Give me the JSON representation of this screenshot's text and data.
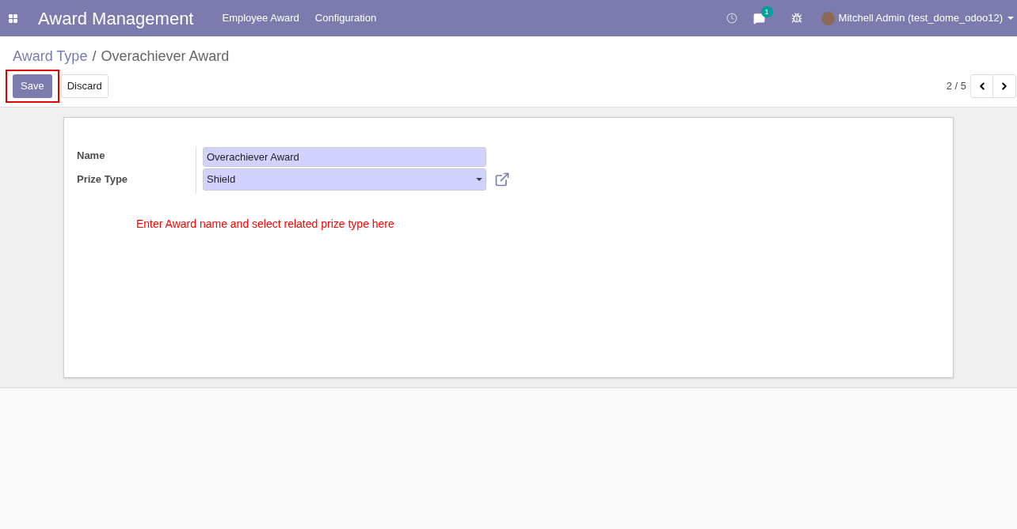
{
  "navbar": {
    "app_title": "Award Management",
    "menus": [
      "Employee Award",
      "Configuration"
    ],
    "messages_badge": "1",
    "user": "Mitchell Admin (test_dome_odoo12)"
  },
  "breadcrumb": {
    "parent": "Award Type",
    "separator": "/",
    "current": "Overachiever Award"
  },
  "buttons": [
    {
      "label": "Save",
      "kind": "primary",
      "highlighted": true
    },
    {
      "label": "Discard",
      "kind": "secondary",
      "highlighted": false
    }
  ],
  "pager": {
    "value": "2 / 5"
  },
  "form": {
    "fields": [
      {
        "label": "Name",
        "kind": "text",
        "value": "Overachiever Award"
      },
      {
        "label": "Prize Type",
        "kind": "select",
        "value": "Shield"
      }
    ],
    "note": "Enter Award name and select related prize type here"
  }
}
